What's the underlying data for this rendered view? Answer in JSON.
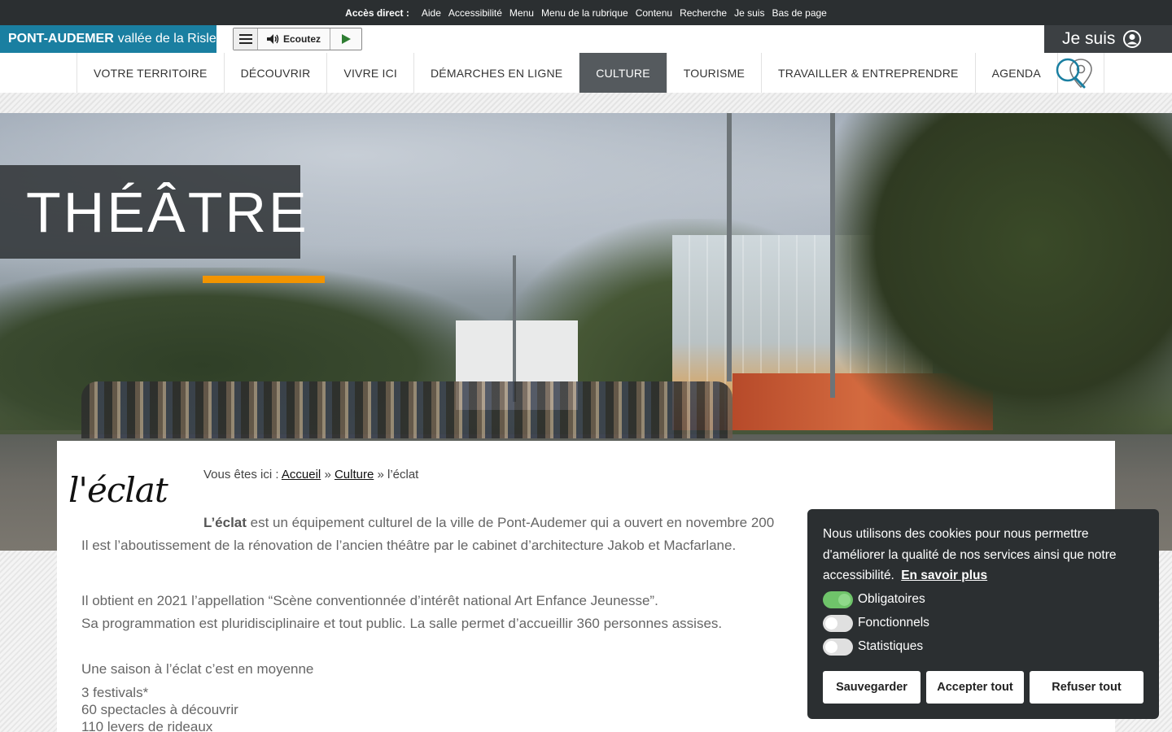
{
  "access_bar": {
    "label": "Accès direct :",
    "links": [
      "Aide",
      "Accessibilité",
      "Menu",
      "Menu de la rubrique",
      "Contenu",
      "Recherche",
      "Je suis",
      "Bas de page"
    ]
  },
  "brand": {
    "strong": "PONT-AUDEMER",
    "rest": "vallée de la Risle"
  },
  "reader": {
    "listen_label": "Ecoutez"
  },
  "jesuis": {
    "label": "Je suis"
  },
  "nav": {
    "items": [
      "VOTRE TERRITOIRE",
      "DÉCOUVRIR",
      "VIVRE ICI",
      "DÉMARCHES EN LIGNE",
      "CULTURE",
      "TOURISME",
      "TRAVAILLER & ENTREPRENDRE",
      "AGENDA"
    ],
    "active": "CULTURE"
  },
  "hero": {
    "title": "THÉÂTRE"
  },
  "content": {
    "logo_text": "l'éclat",
    "breadcrumb": {
      "prefix": "Vous êtes ici :",
      "home": "Accueil",
      "sep": "»",
      "section": "Culture",
      "current": "l’éclat"
    },
    "p1_bold": "L’éclat",
    "p1_rest": " est un équipement culturel de la ville de Pont-Audemer qui a ouvert en novembre 200",
    "p2": "Il est l’aboutissement de la rénovation de l’ancien théâtre par le cabinet d’architecture Jakob et Macfarlane.",
    "p3": "Il obtient en 2021 l’appellation “Scène conventionnée d’intérêt national Art Enfance Jeunesse”.",
    "p4": "Sa programmation est pluridisciplinaire et tout public. La salle permet d’accueillir 360 personnes assises.",
    "p5": "Une saison à l’éclat c’est en moyenne",
    "list": [
      "3 festivals*",
      "60 spectacles à découvrir",
      "110 levers de rideaux"
    ]
  },
  "cookie": {
    "text": "Nous utilisons des cookies pour nous permettre d'améliorer la qualité de nos services ainsi que notre accessibilité.",
    "link": "En savoir plus",
    "toggles": [
      {
        "label": "Obligatoires",
        "on": true
      },
      {
        "label": "Fonctionnels",
        "on": false
      },
      {
        "label": "Statistiques",
        "on": false
      }
    ],
    "buttons": {
      "save": "Sauvegarder",
      "accept": "Accepter tout",
      "refuse": "Refuser tout"
    }
  },
  "colors": {
    "brand_blue": "#1a7fa1",
    "dark": "#2b2f31",
    "accent_orange": "#f29400",
    "nav_active": "#555a5e",
    "toggle_on": "#6fc46a"
  }
}
